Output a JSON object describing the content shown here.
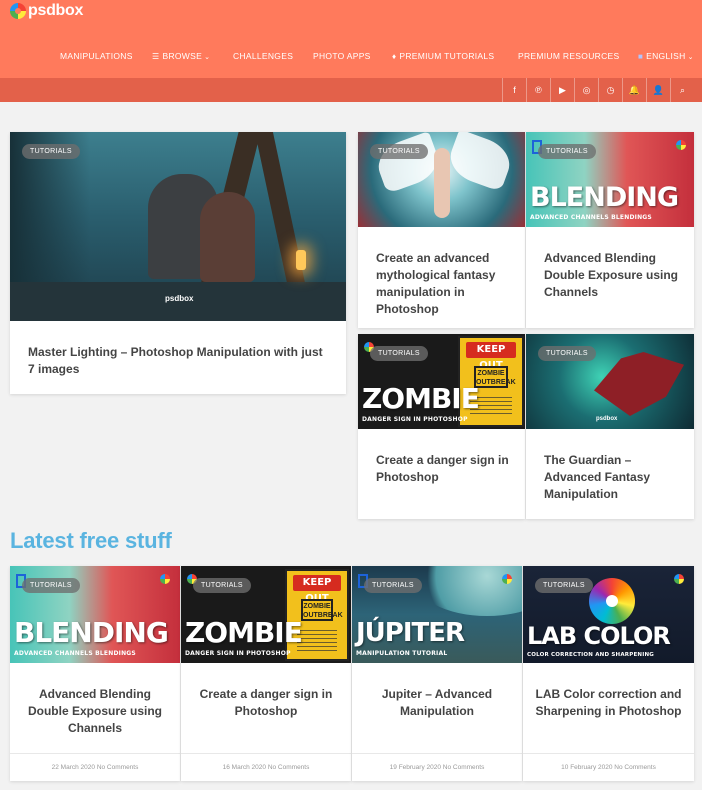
{
  "brand": {
    "name": "psdbox",
    "watermark": "psdbox"
  },
  "nav": {
    "items": [
      {
        "label": "MANIPULATIONS"
      },
      {
        "label": "BROWSE",
        "icon": "menu-icon",
        "chevron": "›"
      },
      {
        "label": "CHALLENGES"
      },
      {
        "label": "PHOTO APPS"
      },
      {
        "label": "PREMIUM TUTORIALS",
        "icon": "diamond-icon"
      },
      {
        "label": "PREMIUM RESOURCES"
      },
      {
        "label": "ENGLISH",
        "icon": "flag-icon",
        "chevron": "›"
      }
    ]
  },
  "social": [
    "facebook-icon",
    "pinterest-icon",
    "youtube-icon",
    "instagram-icon",
    "clock-icon",
    "bell-icon",
    "user-icon",
    "search-icon"
  ],
  "featured": [
    {
      "tag": "TUTORIALS",
      "title": "Master Lighting – Photoshop Manipulation with just 7 images"
    },
    {
      "tag": "TUTORIALS",
      "title": "Create an advanced mythological fantasy manipulation in Photoshop"
    },
    {
      "tag": "TUTORIALS",
      "title": "Advanced Blending Double Exposure using Channels",
      "thumb_text": "BLENDING",
      "thumb_sub": "ADVANCED CHANNELS BLENDINGS"
    },
    {
      "tag": "TUTORIALS",
      "title": "Create a danger sign in Photoshop",
      "thumb_text": "ZOMBIE",
      "thumb_sub": "DANGER SIGN IN PHOTOSHOP",
      "sign_head": "KEEP OUT",
      "sign_mid": "ZOMBIE OUTBREAK"
    },
    {
      "tag": "TUTORIALS",
      "title": "The Guardian – Advanced Fantasy Manipulation"
    }
  ],
  "latest": {
    "heading": "Latest free stuff",
    "items": [
      {
        "tag": "TUTORIALS",
        "title": "Advanced Blending Double Exposure using Channels",
        "date": "22 March 2020",
        "comments": "No Comments",
        "thumb_text": "BLENDING",
        "thumb_sub": "ADVANCED CHANNELS BLENDINGS"
      },
      {
        "tag": "TUTORIALS",
        "title": "Create a danger sign in Photoshop",
        "date": "16 March 2020",
        "comments": "No Comments",
        "thumb_text": "ZOMBIE",
        "thumb_sub": "DANGER SIGN IN PHOTOSHOP",
        "sign_head": "KEEP OUT",
        "sign_mid": "ZOMBIE OUTBREAK"
      },
      {
        "tag": "TUTORIALS",
        "title": "Jupiter – Advanced Manipulation",
        "date": "19 February 2020",
        "comments": "No Comments",
        "thumb_text": "JÚPITER",
        "thumb_sub": "MANIPULATION TUTORIAL"
      },
      {
        "tag": "TUTORIALS",
        "title": "LAB Color correction and Sharpening in Photoshop",
        "date": "10 February 2020",
        "comments": "No Comments",
        "thumb_text": "LAB COLOR",
        "thumb_sub": "COLOR CORRECTION AND SHARPENING"
      }
    ]
  },
  "colors": {
    "header": "#ff7a5c",
    "socialbar": "#e3614a",
    "section_title": "#5ab4e0",
    "card_title": "#444444"
  }
}
